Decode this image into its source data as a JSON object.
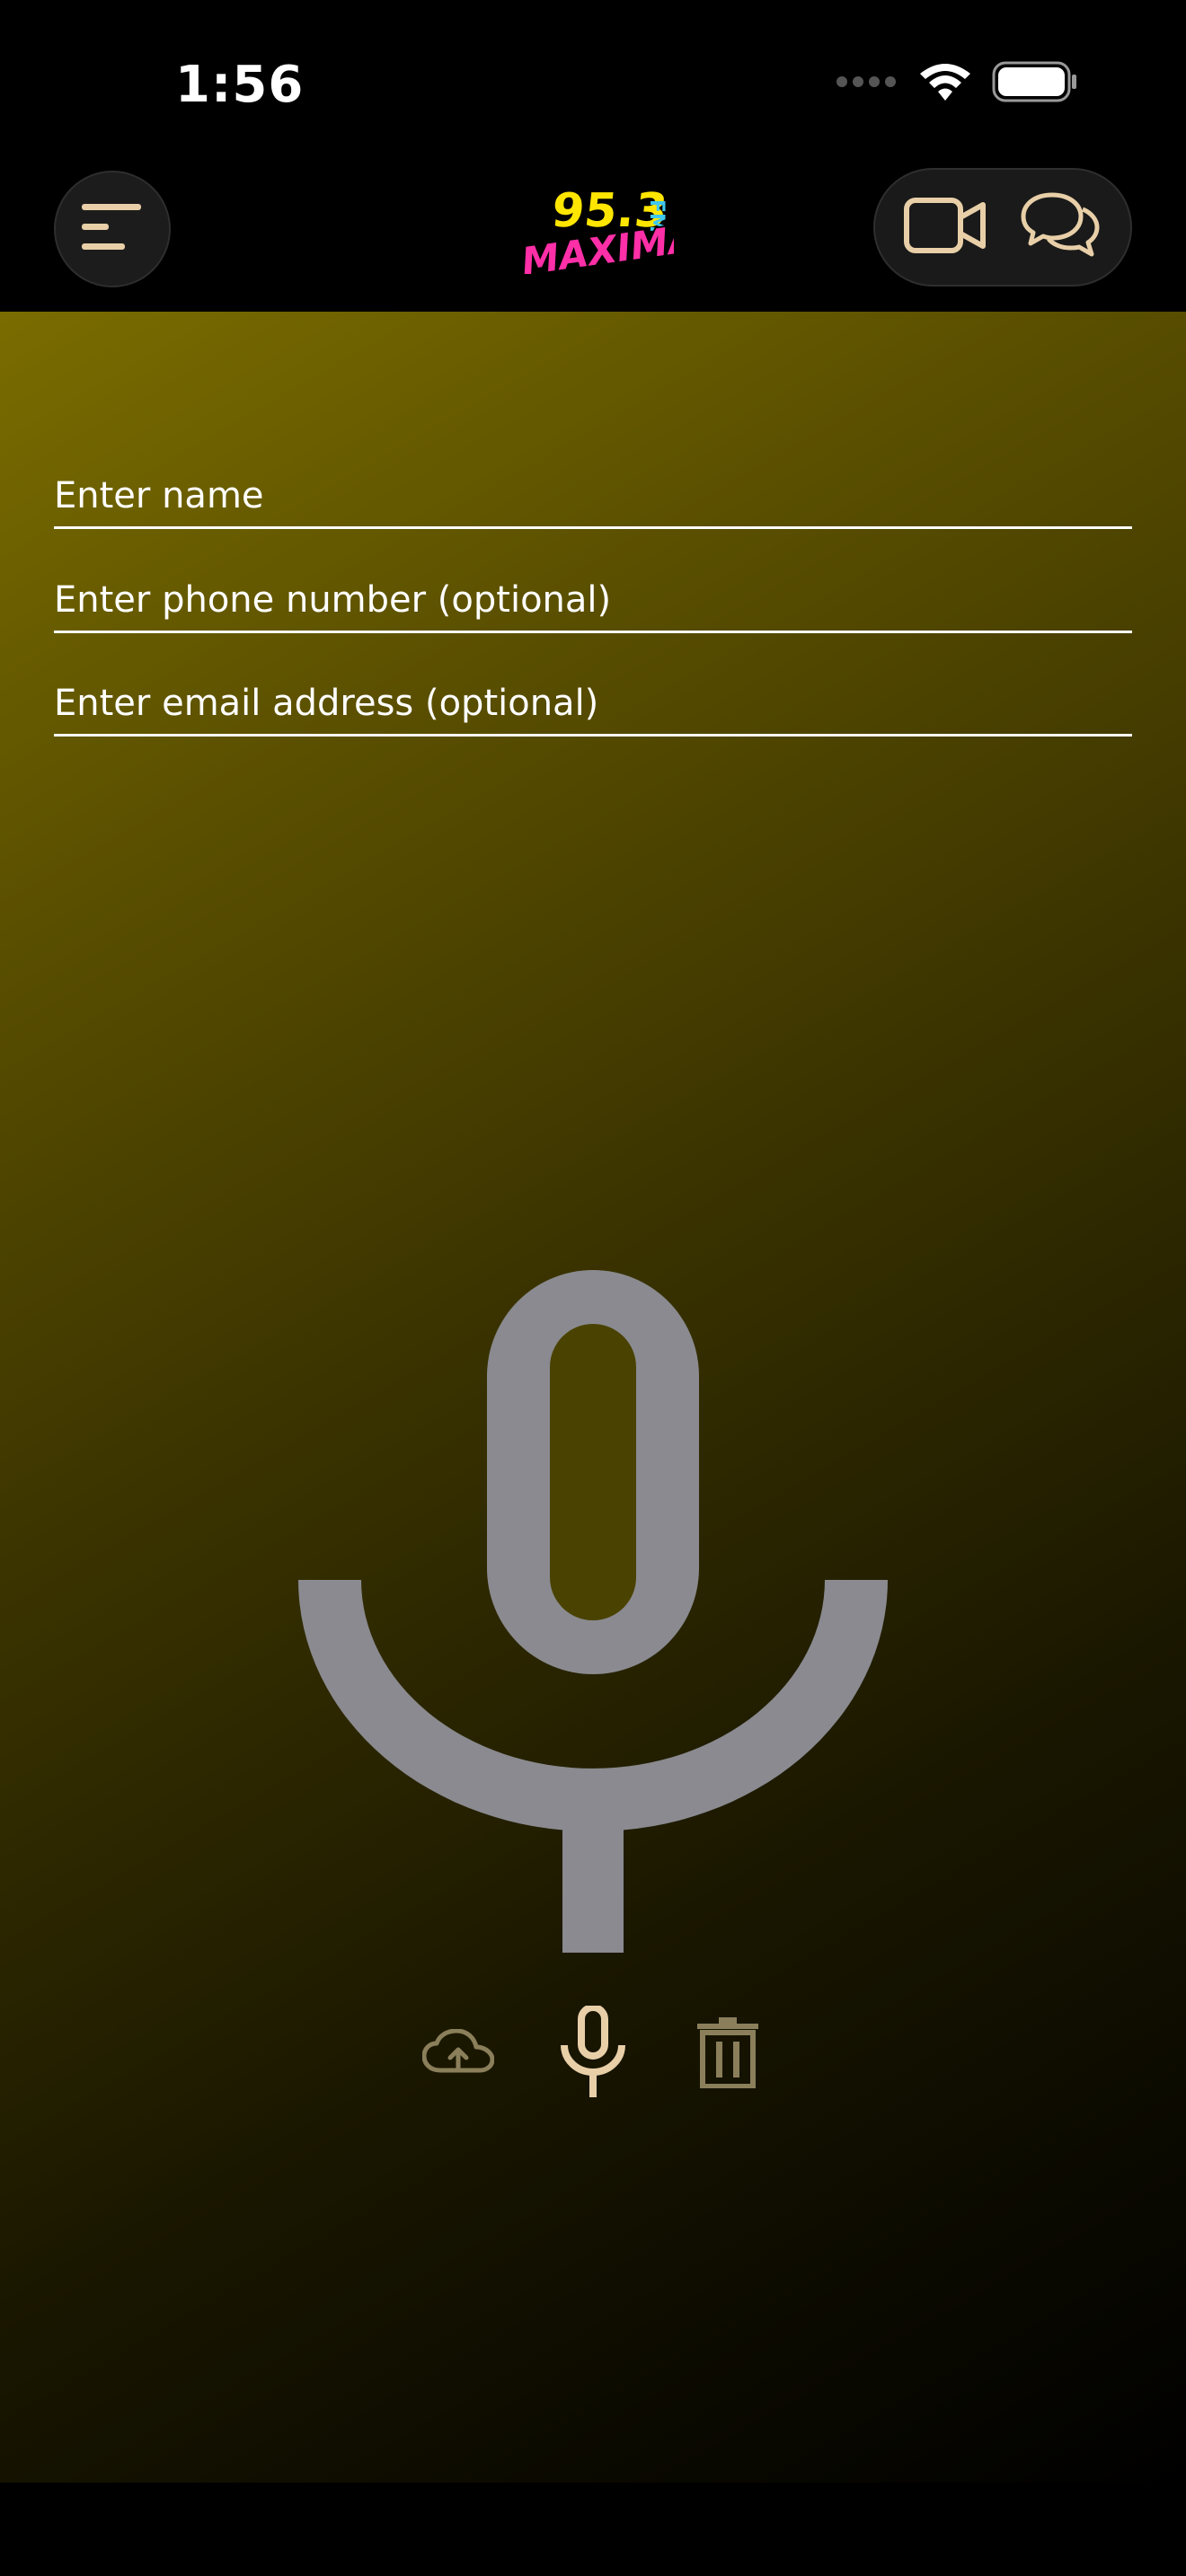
{
  "status_bar": {
    "time": "1:56"
  },
  "nav": {
    "menu_icon": "menu-lines-icon",
    "logo": {
      "number": "95.3",
      "band": "FM",
      "name": "MAXIMA"
    },
    "video_icon": "video-camera-icon",
    "chat_icon": "chat-bubbles-icon"
  },
  "form": {
    "name_placeholder": "Enter name",
    "phone_placeholder": "Enter phone number (optional)",
    "email_placeholder": "Enter email address (optional)"
  },
  "recorder": {
    "big_icon": "microphone-icon",
    "upload_icon": "cloud-upload-icon",
    "record_icon": "microphone-icon",
    "delete_icon": "trash-icon"
  },
  "colors": {
    "accent": "#e8cfa8",
    "gradient_top": "#7a6c00",
    "mic_gray": "#8a8a90",
    "logo_yellow": "#ffe600",
    "logo_pink": "#ff2fa8",
    "logo_cyan": "#3fc8f0"
  }
}
